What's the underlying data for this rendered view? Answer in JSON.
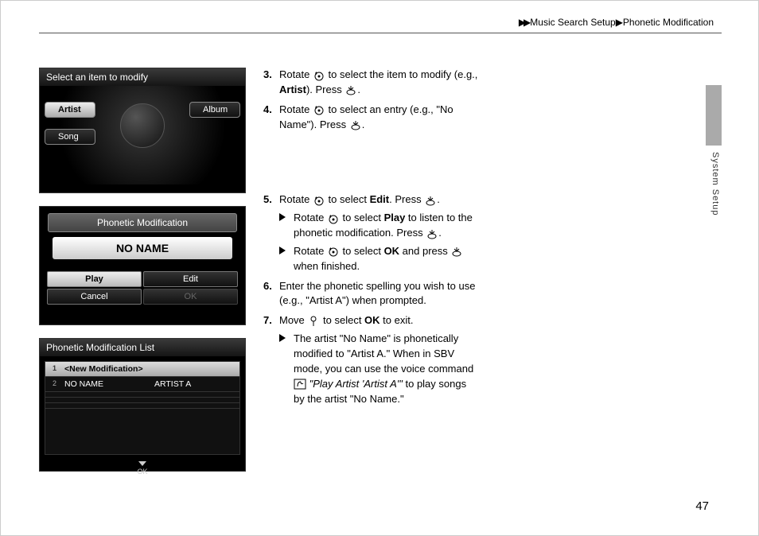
{
  "header": {
    "breadcrumb1": "Music Search Setup",
    "breadcrumb2": "Phonetic Modification"
  },
  "sideLabel": "System Setup",
  "pageNumber": "47",
  "screen1": {
    "title": "Select an item to modify",
    "options": {
      "artist": "Artist",
      "album": "Album",
      "song": "Song"
    }
  },
  "screen2": {
    "title": "Phonetic Modification",
    "selected": "NO NAME",
    "buttons": {
      "play": "Play",
      "edit": "Edit",
      "cancel": "Cancel",
      "ok": "OK"
    }
  },
  "screen3": {
    "title": "Phonetic Modification List",
    "rows": [
      {
        "idx": "1",
        "a": "<New Modification>",
        "b": ""
      },
      {
        "idx": "2",
        "a": "NO NAME",
        "b": "ARTIST A"
      }
    ],
    "ok": "OK"
  },
  "steps": {
    "s3a": "Rotate ",
    "s3b": " to select the item to modify (e.g., ",
    "s3c": "Artist",
    "s3d": "). Press ",
    "s4a": "Rotate ",
    "s4b": " to select an entry (e.g., \"No Name\"). Press ",
    "s5a": "Rotate ",
    "s5b": " to select ",
    "s5c": "Edit",
    "s5d": ". Press ",
    "s5sub1a": "Rotate ",
    "s5sub1b": " to select ",
    "s5sub1c": "Play",
    "s5sub1d": " to listen to the phonetic modification. Press ",
    "s5sub2a": "Rotate ",
    "s5sub2b": " to select ",
    "s5sub2c": "OK",
    "s5sub2d": " and press ",
    "s5sub2e": " when finished.",
    "s6": "Enter the phonetic spelling you wish to use (e.g., \"Artist A\") when prompted.",
    "s7a": "Move ",
    "s7b": " to select ",
    "s7c": "OK",
    "s7d": " to exit.",
    "s7sub1a": "The artist \"No Name\" is phonetically modified to \"Artist A.\" When in SBV mode, you can use the voice command ",
    "s7sub1b": "\"Play Artist 'Artist A'\"",
    "s7sub1c": " to play songs by the artist \"No Name.\""
  },
  "nums": {
    "n3": "3.",
    "n4": "4.",
    "n5": "5.",
    "n6": "6.",
    "n7": "7."
  }
}
